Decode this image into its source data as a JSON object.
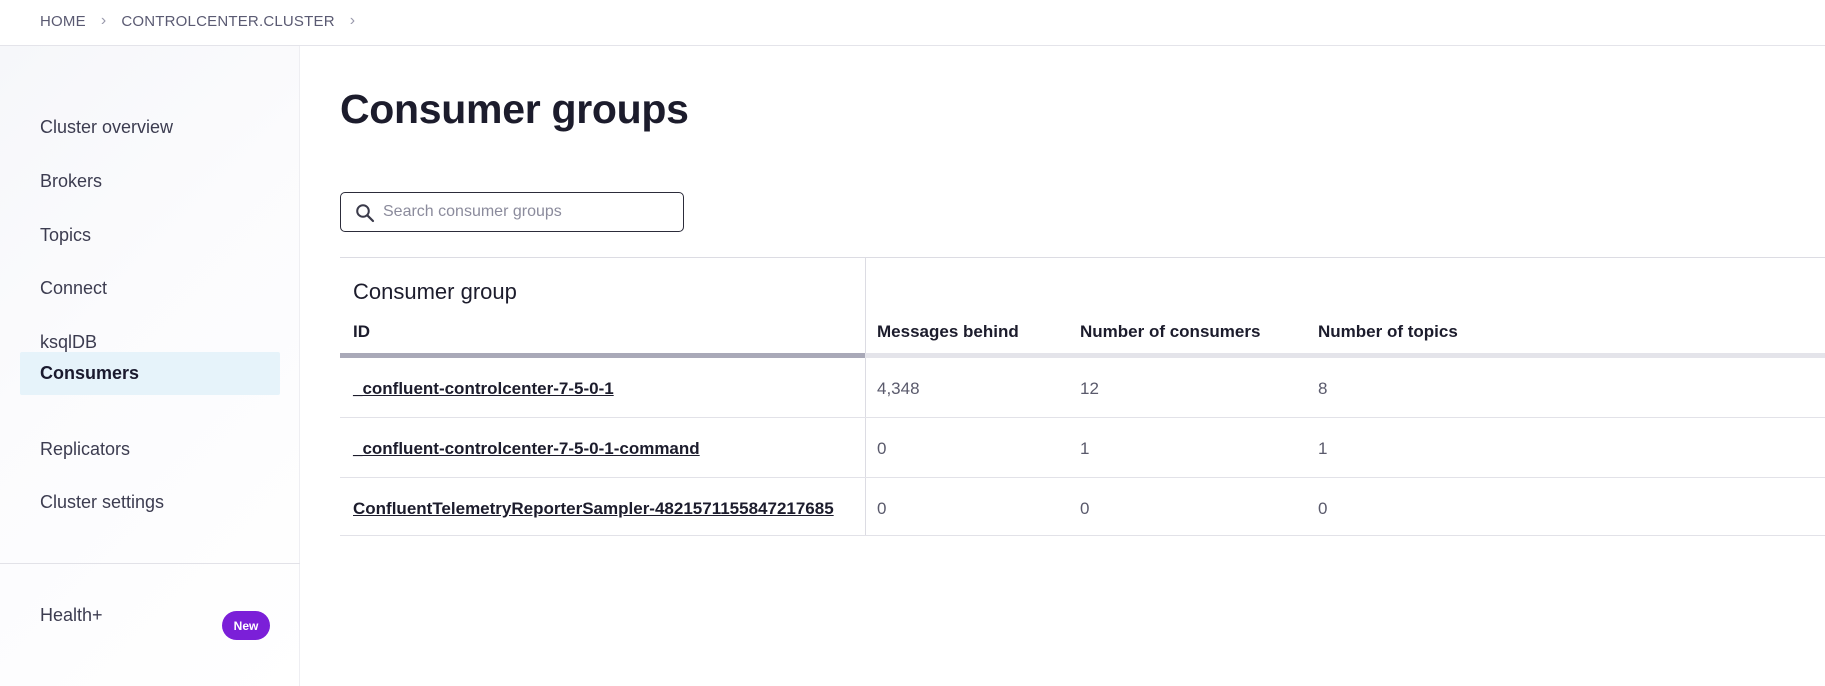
{
  "breadcrumb": {
    "home": "HOME",
    "cluster": "CONTROLCENTER.CLUSTER",
    "separator": "›"
  },
  "sidebar": {
    "items": [
      {
        "label": "Cluster overview",
        "active": false
      },
      {
        "label": "Brokers",
        "active": false
      },
      {
        "label": "Topics",
        "active": false
      },
      {
        "label": "Connect",
        "active": false
      },
      {
        "label": "ksqlDB",
        "active": false
      },
      {
        "label": "Consumers",
        "active": true
      },
      {
        "label": "Replicators",
        "active": false
      },
      {
        "label": "Cluster settings",
        "active": false
      }
    ],
    "health": {
      "label": "Health+",
      "badge": "New",
      "badge_color": "#7b1fd8"
    },
    "active_color": "#e6f3fa"
  },
  "main": {
    "title": "Consumer groups",
    "search": {
      "placeholder": "Search consumer groups",
      "value": ""
    },
    "table": {
      "group_header": "Consumer group",
      "columns": [
        "ID",
        "Messages behind",
        "Number of consumers",
        "Number of topics"
      ],
      "rows": [
        {
          "id": "_confluent-controlcenter-7-5-0-1",
          "messages_behind": "4,348",
          "consumers": "12",
          "topics": "8"
        },
        {
          "id": "_confluent-controlcenter-7-5-0-1-command",
          "messages_behind": "0",
          "consumers": "1",
          "topics": "1"
        },
        {
          "id": "ConfluentTelemetryReporterSampler-4821571155847217685",
          "messages_behind": "0",
          "consumers": "0",
          "topics": "0"
        }
      ]
    }
  },
  "icons": {
    "search": "search-icon",
    "breadcrumb_separator": "chevron-right-icon"
  }
}
